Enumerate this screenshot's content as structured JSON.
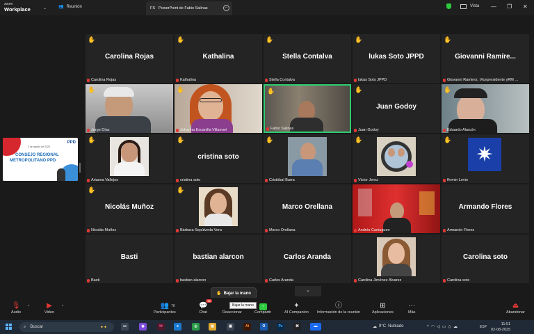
{
  "app": {
    "logo_line1": "zoom",
    "logo_line2": "Workplace",
    "meeting_tab": "Reunión"
  },
  "share_tab": {
    "initials": "FS",
    "title": "PowerPoint de Fabio Salinas"
  },
  "view": {
    "label": "Vista"
  },
  "slide": {
    "logo": "PPD",
    "date": "2 de agosto de 2025",
    "title1": "CONSEJO REGIONAL",
    "title2": "METROPOLITANO PPD"
  },
  "tiles": [
    {
      "big": "Carolina Rojas",
      "tag": "Carolina Rojas"
    },
    {
      "big": "Kathalina",
      "tag": "Kathalina"
    },
    {
      "big": "Stella Contalva",
      "tag": "Stella Contalva"
    },
    {
      "big": "lukas Soto JPPD",
      "tag": "lukas Soto JPPD"
    },
    {
      "big": "Giovanni  Ramíre...",
      "tag": "Giovanni Ramirez, Vicepresidente yRM ..."
    },
    {
      "tag": "Jorge Díaz"
    },
    {
      "tag": "Johanna Escanilla Villarroel"
    },
    {
      "tag": "Fabio Salinas"
    },
    {
      "big": "Juan Godoy",
      "tag": "Juan Godoy"
    },
    {
      "tag": "Eduardo Alarcón"
    },
    {
      "tag": "Ariasna Vallejos"
    },
    {
      "big": "cristina soto",
      "tag": "cristina soto"
    },
    {
      "tag": "Cristóbal Barra"
    },
    {
      "tag": "Victor Jerez"
    },
    {
      "tag": "fhrmin Levio"
    },
    {
      "big": "Nicolás Muñoz",
      "tag": "Nicolás Muñoz"
    },
    {
      "tag": "Bárbara Sepúlveda Vera"
    },
    {
      "big": "Marco Orellana",
      "tag": "Marco Orellana"
    },
    {
      "tag": "Andrés Caniuqueo"
    },
    {
      "big": "Armando Flores",
      "tag": "Armando Flores"
    },
    {
      "big": "Basti",
      "tag": "Basti"
    },
    {
      "big": "bastian alarcon",
      "tag": "bastian alarcon"
    },
    {
      "big": "Carlos Aranda",
      "tag": "Carlos Aranda"
    },
    {
      "tag": "Carolina Jiménez Álvarez"
    },
    {
      "big": "Carolina soto",
      "tag": "Carolina soto"
    }
  ],
  "toolbar": {
    "audio": "Audio",
    "video": "Video",
    "participants": "Participantes",
    "participants_count": "78",
    "chat": "Chat",
    "chat_badge": "12",
    "react": "Reaccionar",
    "share": "Compartir",
    "ai": "AI Companion",
    "info": "Información de la reunión",
    "apps": "Aplicaciones",
    "more": "Más",
    "leave": "Abandonar",
    "lower_hand": "Bajar la mano",
    "tooltip": "Bajar la mano"
  },
  "taskbar": {
    "search": "Buscar",
    "temp": "9°C",
    "weather": "Nublado",
    "lang": "ESP",
    "time": "11:51",
    "date": "02-08-2025"
  }
}
